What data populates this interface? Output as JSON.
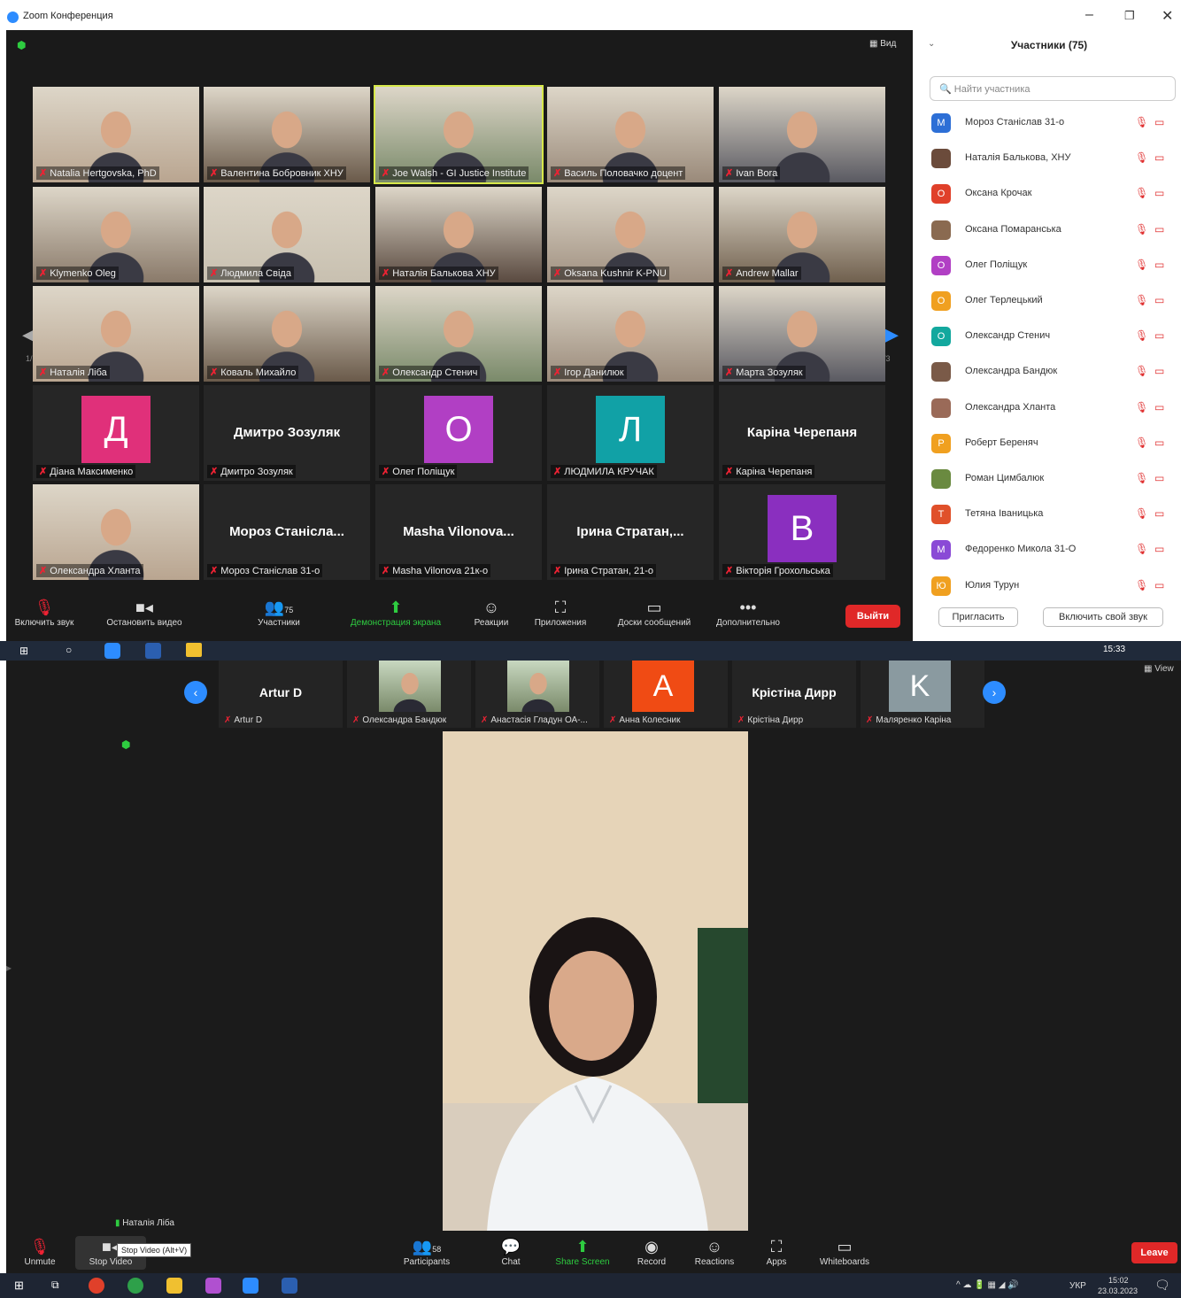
{
  "window1": {
    "title": "Zoom Конференция",
    "view_label": "Вид",
    "page_left": "1/3",
    "page_right": "1/3"
  },
  "tiles": [
    {
      "name": "Natalia Hertgovska, PhD",
      "type": "video"
    },
    {
      "name": "Валентина Бобровник ХНУ",
      "type": "video"
    },
    {
      "name": "Joe Walsh - GI Justice Institute",
      "type": "video"
    },
    {
      "name": "Василь Половачко доцент",
      "type": "video"
    },
    {
      "name": "Ivan Bora",
      "type": "video"
    },
    {
      "name": "Klymenko Oleg",
      "type": "video"
    },
    {
      "name": "Людмила Свіда",
      "type": "video"
    },
    {
      "name": "Наталія Балькова ХНУ",
      "type": "video"
    },
    {
      "name": "Oksana Kushnir K-PNU",
      "type": "video"
    },
    {
      "name": "Andrew Mallar",
      "type": "video"
    },
    {
      "name": "Наталія Ліба",
      "type": "video"
    },
    {
      "name": "Коваль Михайло",
      "type": "video"
    },
    {
      "name": "Олександр Стенич",
      "type": "video"
    },
    {
      "name": "Ігор Данилюк",
      "type": "video"
    },
    {
      "name": "Марта Зозуляк",
      "type": "video"
    },
    {
      "name": "Діана Максименко",
      "type": "avatar",
      "initial": "Д",
      "color": "#e0307a"
    },
    {
      "name": "Дмитро Зозуляк",
      "type": "text",
      "display": "Дмитро Зозуляк"
    },
    {
      "name": "Олег Поліщук",
      "type": "avatar",
      "initial": "О",
      "color": "#b13fc4"
    },
    {
      "name": "ЛЮДМИЛА КРУЧАК",
      "type": "avatar",
      "initial": "Л",
      "color": "#11a1a6"
    },
    {
      "name": "Каріна Черепаня",
      "type": "text",
      "display": "Каріна Черепаня"
    },
    {
      "name": "Олександра Хланта",
      "type": "video"
    },
    {
      "name": "Мороз Станіслав 31-о",
      "type": "text",
      "display": "Мороз Станісла..."
    },
    {
      "name": "Masha Vilonova 21к-о",
      "type": "text",
      "display": "Masha Vilonova..."
    },
    {
      "name": "Ірина Стратан, 21-о",
      "type": "text",
      "display": "Ірина Стратан,..."
    },
    {
      "name": "Вікторія Грохольська",
      "type": "avatar",
      "initial": "В",
      "color": "#8a2fbf"
    }
  ],
  "toolbar1": {
    "unmute": "Включить звук",
    "stop_video": "Остановить видео",
    "participants": "Участники",
    "participants_count": "75",
    "share": "Демонстрация экрана",
    "reactions": "Реакции",
    "apps": "Приложения",
    "whiteboards": "Доски сообщений",
    "more": "Дополнительно",
    "leave": "Выйти"
  },
  "panel": {
    "title": "Участники (75)",
    "search_placeholder": "Найти участника",
    "invite": "Пригласить",
    "unmute_self": "Включить свой звук",
    "participants": [
      {
        "name": "Мороз Станіслав 31-о",
        "initial": "М",
        "color": "#2d6fd6"
      },
      {
        "name": "Наталія Балькова, ХНУ",
        "initial": "",
        "color": "#6b4b3b"
      },
      {
        "name": "Оксана Крочак",
        "initial": "О",
        "color": "#e0402a"
      },
      {
        "name": "Оксана Помаранська",
        "initial": "",
        "color": "#8a6a50"
      },
      {
        "name": "Олег Поліщук",
        "initial": "О",
        "color": "#b13fc4"
      },
      {
        "name": "Олег Терлецький",
        "initial": "О",
        "color": "#f0a020"
      },
      {
        "name": "Олександр Стенич",
        "initial": "О",
        "color": "#13a89e"
      },
      {
        "name": "Олександра Бандюк",
        "initial": "",
        "color": "#7a5a48"
      },
      {
        "name": "Олександра Хланта",
        "initial": "",
        "color": "#9a6a58"
      },
      {
        "name": "Роберт Береняч",
        "initial": "Р",
        "color": "#f0a020"
      },
      {
        "name": "Роман Цимбалюк",
        "initial": "",
        "color": "#6a8a40"
      },
      {
        "name": "Тетяна Іваницька",
        "initial": "Т",
        "color": "#e0502a"
      },
      {
        "name": "Федоренко Микола 31-О",
        "initial": "М",
        "color": "#8a4ad6"
      },
      {
        "name": "Юлия Турун",
        "initial": "Ю",
        "color": "#f0a020"
      }
    ]
  },
  "taskbar1_time": "15:33",
  "window2": {
    "view_label": "View",
    "strip": [
      {
        "name": "Artur D",
        "display": "Artur D",
        "type": "text"
      },
      {
        "name": "Олександра Бандюк",
        "type": "video"
      },
      {
        "name": "Анастасія Гладун ОА-...",
        "type": "video"
      },
      {
        "name": "Анна Колесник",
        "initial": "A",
        "color": "#f04b14",
        "type": "avatar"
      },
      {
        "name": "Крістіна Дирр",
        "display": "Крістіна Дирр",
        "type": "text"
      },
      {
        "name": "Маляренко Каріна",
        "initial": "K",
        "color": "#8a9aa0",
        "type": "avatar"
      }
    ],
    "speaker_label": "Наталія Ліба",
    "tooltip": "Stop Video (Alt+V)"
  },
  "toolbar2": {
    "unmute": "Unmute",
    "stop_video": "Stop Video",
    "participants": "Participants",
    "participants_count": "58",
    "chat": "Chat",
    "share": "Share Screen",
    "record": "Record",
    "reactions": "Reactions",
    "apps": "Apps",
    "whiteboards": "Whiteboards",
    "leave": "Leave"
  },
  "taskbar2": {
    "lang": "УКР",
    "time": "15:02",
    "date": "23.03.2023"
  }
}
